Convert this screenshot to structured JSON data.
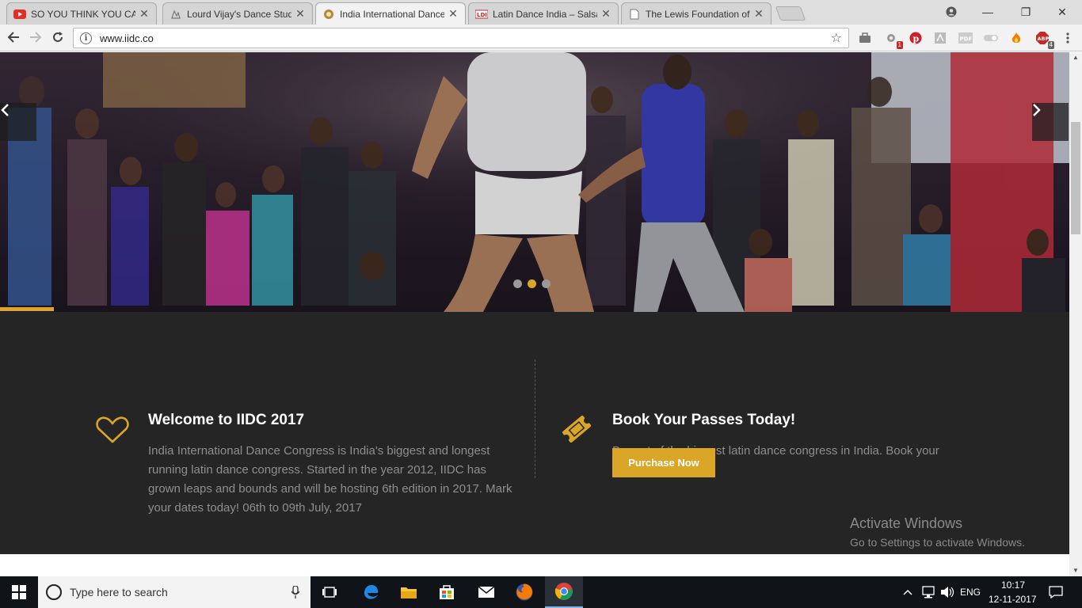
{
  "browser": {
    "tabs": [
      {
        "title": "SO YOU THINK YOU CAN",
        "icon": "youtube-icon",
        "active": false
      },
      {
        "title": "Lourd Vijay's Dance Stud",
        "icon": "page-icon",
        "active": false
      },
      {
        "title": "India International Dance",
        "icon": "iidc-icon",
        "active": true
      },
      {
        "title": "Latin Dance India – Salsa",
        "icon": "ldi-icon",
        "active": false
      },
      {
        "title": "The Lewis Foundation of",
        "icon": "doc-icon",
        "active": false
      }
    ],
    "url": "www.iidc.co",
    "extension_badges": {
      "first": "1",
      "abp": "4"
    },
    "extension_labels": {
      "pdf": "PDF",
      "abp": "ABP"
    }
  },
  "hero": {
    "slide_count": 3,
    "active_slide": 2,
    "progress": 0.05
  },
  "intro": {
    "left": {
      "title": "Welcome to IIDC 2017",
      "body": "India International Dance Congress is India's biggest and longest running latin dance congress. Started in the year 2012, IIDC has grown leaps and bounds and will be hosting 6th edition in 2017. Mark your dates today! 06th to 09th July, 2017"
    },
    "right": {
      "title": "Book Your Passes Today!",
      "body": "Be part of the biggest latin dance congress in India. Book your passes today.",
      "button": "Purchase Now"
    }
  },
  "watermark": {
    "title": "Activate Windows",
    "subtitle": "Go to Settings to activate Windows."
  },
  "taskbar": {
    "search_placeholder": "Type here to search",
    "language": "ENG",
    "time": "10:17",
    "date": "12-11-2017"
  },
  "colors": {
    "accent": "#dba628",
    "section_bg": "#252525"
  }
}
